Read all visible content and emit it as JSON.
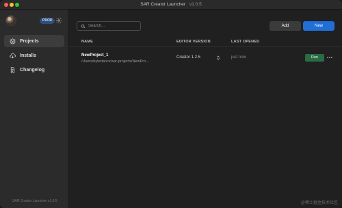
{
  "window": {
    "title": "SAR Creator Launcher",
    "version": "v1.0.5"
  },
  "sidebar": {
    "env_badge": "PROD",
    "items": [
      {
        "label": "Projects",
        "icon": "layers-icon",
        "active": true
      },
      {
        "label": "Installs",
        "icon": "cloud-download-icon",
        "active": false
      },
      {
        "label": "Changelog",
        "icon": "document-icon",
        "active": false
      }
    ],
    "footer": "SAR Creator Launcher v1.0.5"
  },
  "toolbar": {
    "search_placeholder": "Search...",
    "add_label": "Add",
    "new_label": "New"
  },
  "table": {
    "columns": [
      "NAME",
      "EDITOR VERSION",
      "LAST OPENED"
    ],
    "rows": [
      {
        "name": "NewProject_1",
        "path": "/Users/bytedance/sar-projects/NewPro...",
        "editor": "Creator 1.2.5",
        "last_opened": "just now",
        "run_label": "Run"
      }
    ]
  },
  "colors": {
    "accent": "#1f6fd6",
    "run": "#2a6a46",
    "badge": "#2e4d7a"
  },
  "watermark": "@稀土掘金技术社区"
}
